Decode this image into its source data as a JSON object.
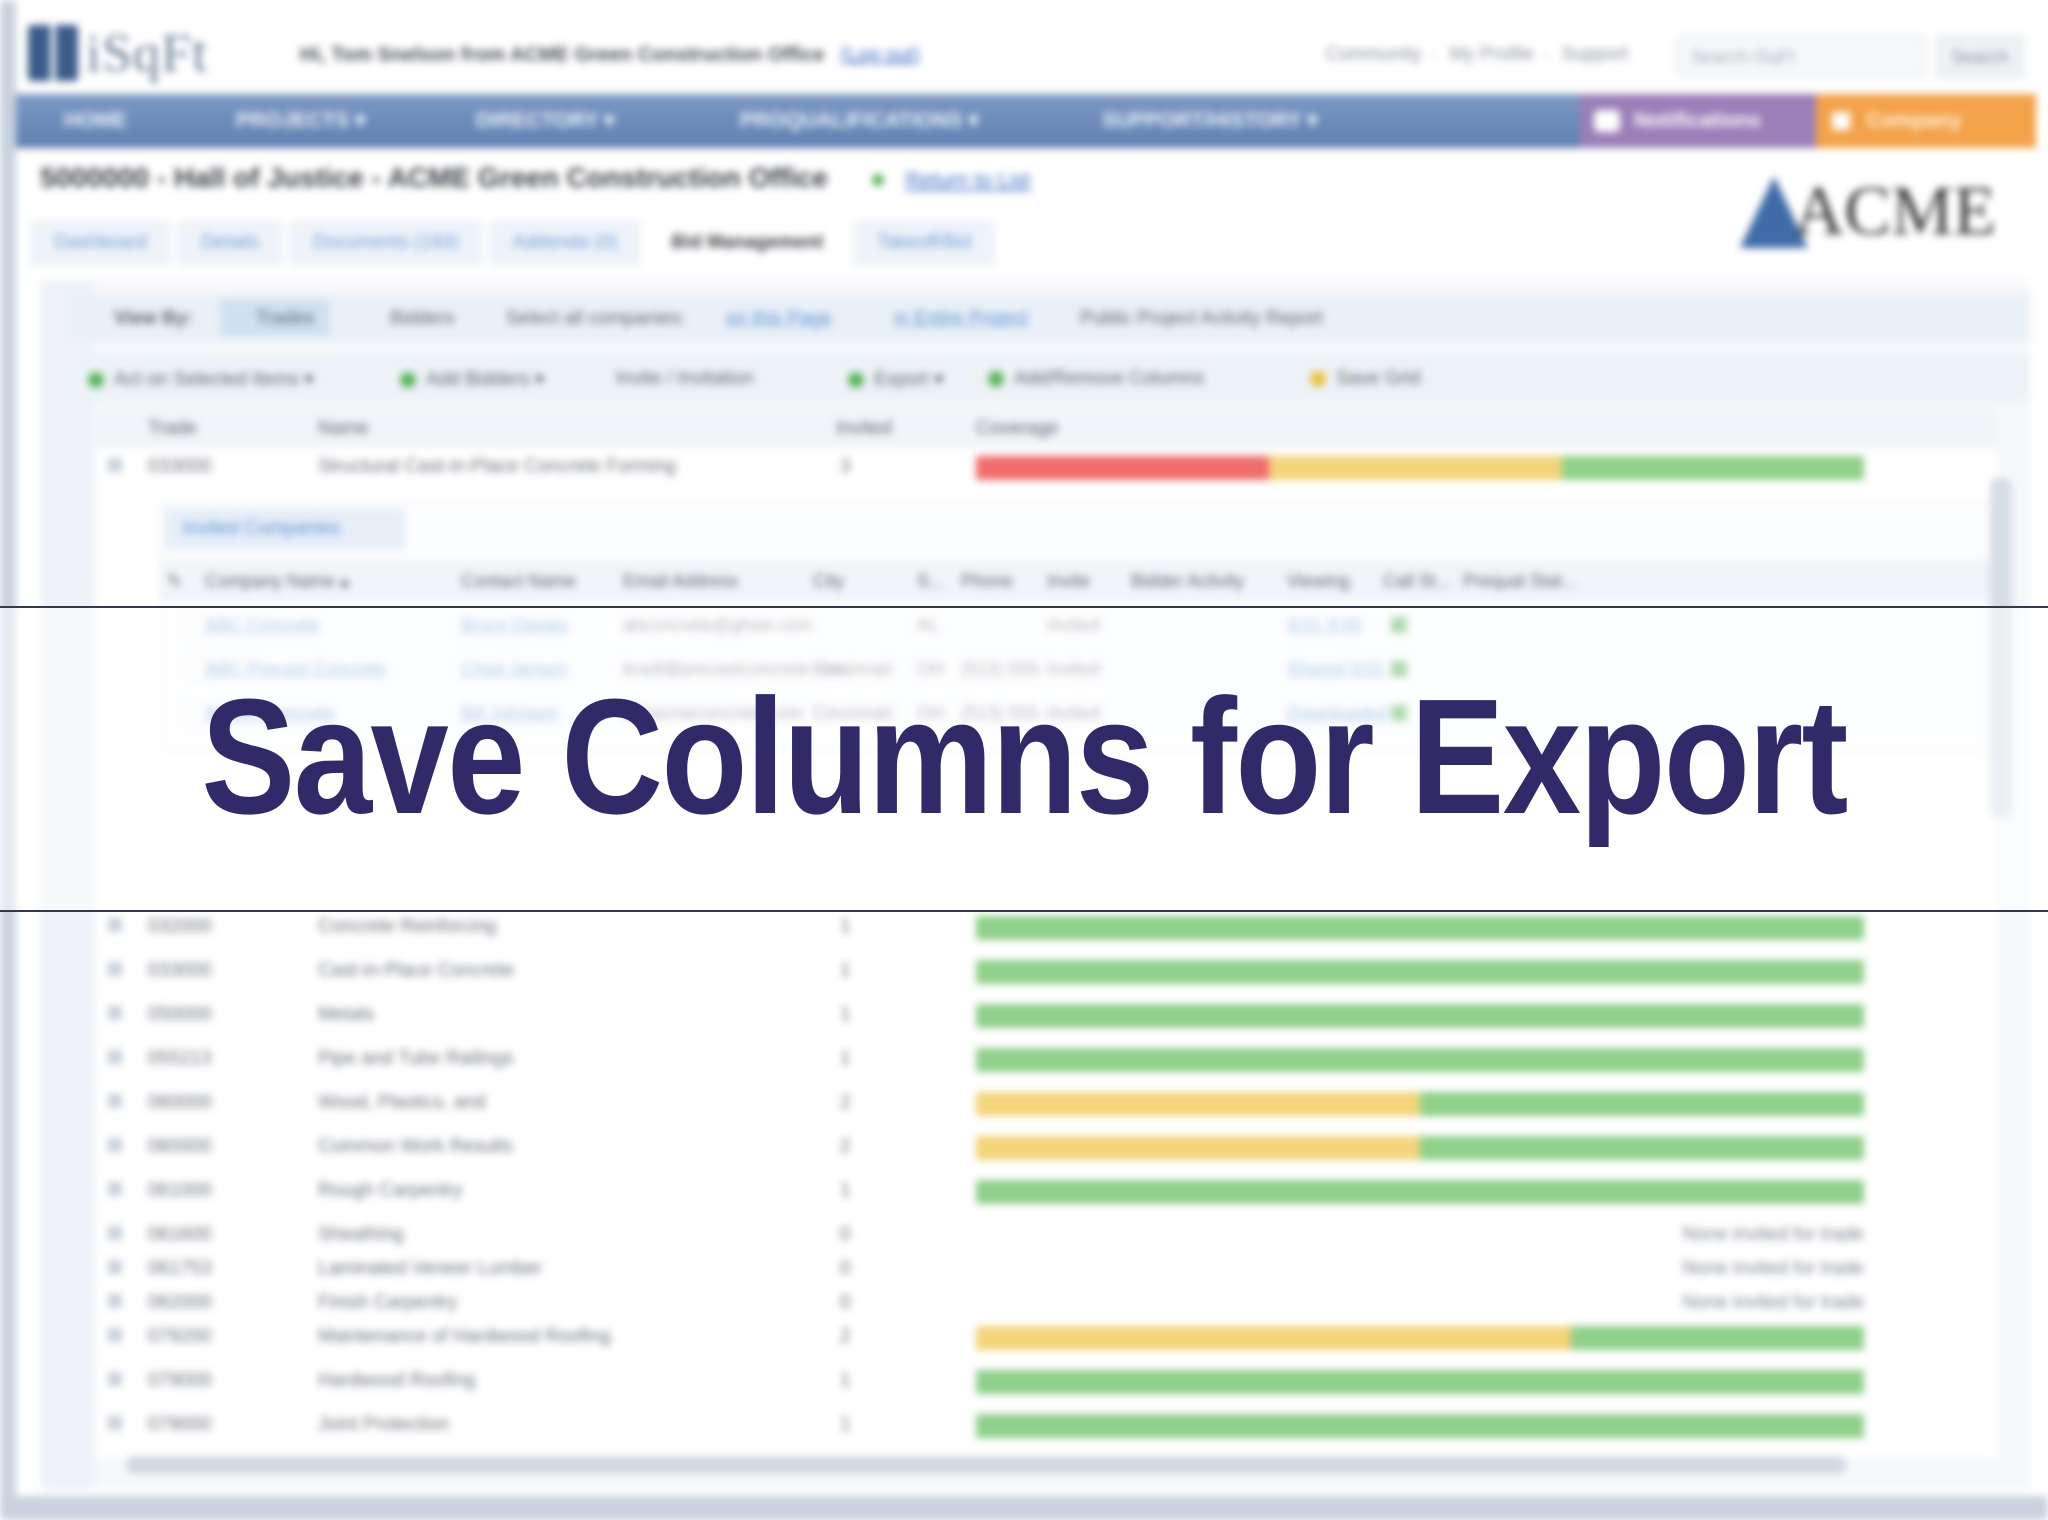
{
  "header": {
    "logo_text": "iSqFt",
    "welcome": "Hi, Tom Snelson from ACME Green Construction Office",
    "logout": "(Log out)",
    "top_links": [
      "Community",
      "My Profile",
      "Support"
    ],
    "search_placeholder": "Search iSqFt",
    "search_button": "Search"
  },
  "nav": {
    "items": [
      "HOME",
      "PROJECTS ▾",
      "DIRECTORY ▾",
      "PROQUALIFICATIONS ▾",
      "SUPPORT/HISTORY ▾"
    ],
    "notifications": "Notifications",
    "orange": "Company"
  },
  "project": {
    "title": "5000000 - Hall of Justice - ACME Green Construction Office",
    "return_link": "Return to List",
    "brand": "ACME"
  },
  "tabs": [
    "Dashboard",
    "Details",
    "Documents (193)",
    "Addenda (0)",
    "Bid Management",
    "Takeoff/Bid"
  ],
  "active_tab_index": 4,
  "toolbar1": {
    "view_by": "View By:",
    "trades": "Trades",
    "bidders": "Bidders",
    "select_all": "Select all companies:",
    "links": [
      "on this Page",
      "in Entire Project"
    ],
    "report": "Public Project Activity Report"
  },
  "toolbar2": {
    "items": [
      "Act on Selected Items ▾",
      "Add Bidders ▾",
      "Invite / Invitation",
      "Export ▾",
      "Add/Remove Columns",
      "Save Grid"
    ]
  },
  "grid": {
    "columns": [
      "Trade",
      "Name",
      "Invited",
      "Coverage"
    ],
    "rows": [
      {
        "code": "033000",
        "name": "Structural Cast-in-Place Concrete Forming",
        "invited": "3",
        "bar": [
          0.33,
          0.33,
          0.34
        ]
      },
      {
        "code": "032000",
        "name": "Concrete Reinforcing",
        "invited": "1",
        "bar": [
          0,
          0,
          1
        ]
      },
      {
        "code": "033000",
        "name": "Cast-in-Place Concrete",
        "invited": "1",
        "bar": [
          0,
          0,
          1
        ]
      },
      {
        "code": "050000",
        "name": "Metals",
        "invited": "1",
        "bar": [
          0,
          0,
          1
        ]
      },
      {
        "code": "055213",
        "name": "Pipe and Tube Railings",
        "invited": "1",
        "bar": [
          0,
          0,
          1
        ]
      },
      {
        "code": "060000",
        "name": "Wood, Plastics, and",
        "invited": "2",
        "bar": [
          0,
          0.5,
          0.5
        ]
      },
      {
        "code": "060000",
        "name": "Common Work Results",
        "invited": "2",
        "bar": [
          0,
          0.5,
          0.5
        ]
      },
      {
        "code": "061000",
        "name": "Rough Carpentry",
        "invited": "1",
        "bar": [
          0,
          0,
          1
        ]
      },
      {
        "code": "061600",
        "name": "Sheathing",
        "invited": "0",
        "note": "None invited for trade"
      },
      {
        "code": "061753",
        "name": "Laminated Veneer Lumber",
        "invited": "0",
        "note": "None invited for trade"
      },
      {
        "code": "062000",
        "name": "Finish Carpentry",
        "invited": "0",
        "note": "None invited for trade"
      },
      {
        "code": "079200",
        "name": "Maintenance of Hardwood Roofing",
        "invited": "2",
        "bar": [
          0,
          0.67,
          0.33
        ]
      },
      {
        "code": "079000",
        "name": "Hardwood Roofing",
        "invited": "1",
        "bar": [
          0,
          0,
          1
        ]
      },
      {
        "code": "079000",
        "name": "Joint Protection",
        "invited": "1",
        "bar": [
          0,
          0,
          1
        ]
      }
    ]
  },
  "subgrid": {
    "tab": "Invited Companies",
    "columns": [
      "Company Name ▴",
      "Contact Name",
      "Email Address",
      "City",
      "S...",
      "Phone",
      "Invite",
      "Bidder Activity",
      "Viewing",
      "Call St...",
      "Prequal Stat..."
    ],
    "rows": [
      {
        "company": "ABC Concrete",
        "contact": "Bruce Davies",
        "email": "abconcrete@ghwe.com",
        "city": "",
        "state": "AL",
        "phone": "",
        "invite": "Invited",
        "viewing": "5/31 9:00"
      },
      {
        "company": "ABC Precast Concrete",
        "contact": "Chad Jansen",
        "email": "bradl@precastconcrete.com",
        "city": "Cincinnati",
        "state": "OH",
        "phone": "(513) 555-",
        "invite": "Invited",
        "viewing": "Shared 5/31"
      },
      {
        "company": "ACME Concrete",
        "contact": "Bill Johnson",
        "email": "b@acmeconcrete.com",
        "city": "Cincinnati",
        "state": "OH",
        "phone": "(513) 555-",
        "invite": "Invited",
        "viewing": "Downloaded"
      }
    ]
  },
  "colors": {
    "red": "#f06c6c",
    "yellow": "#f3d47a",
    "green": "#8fd08a",
    "nav": "#6c8cbd",
    "headline": "#322a68"
  },
  "overlay": {
    "headline": "Save Columns for Export"
  }
}
